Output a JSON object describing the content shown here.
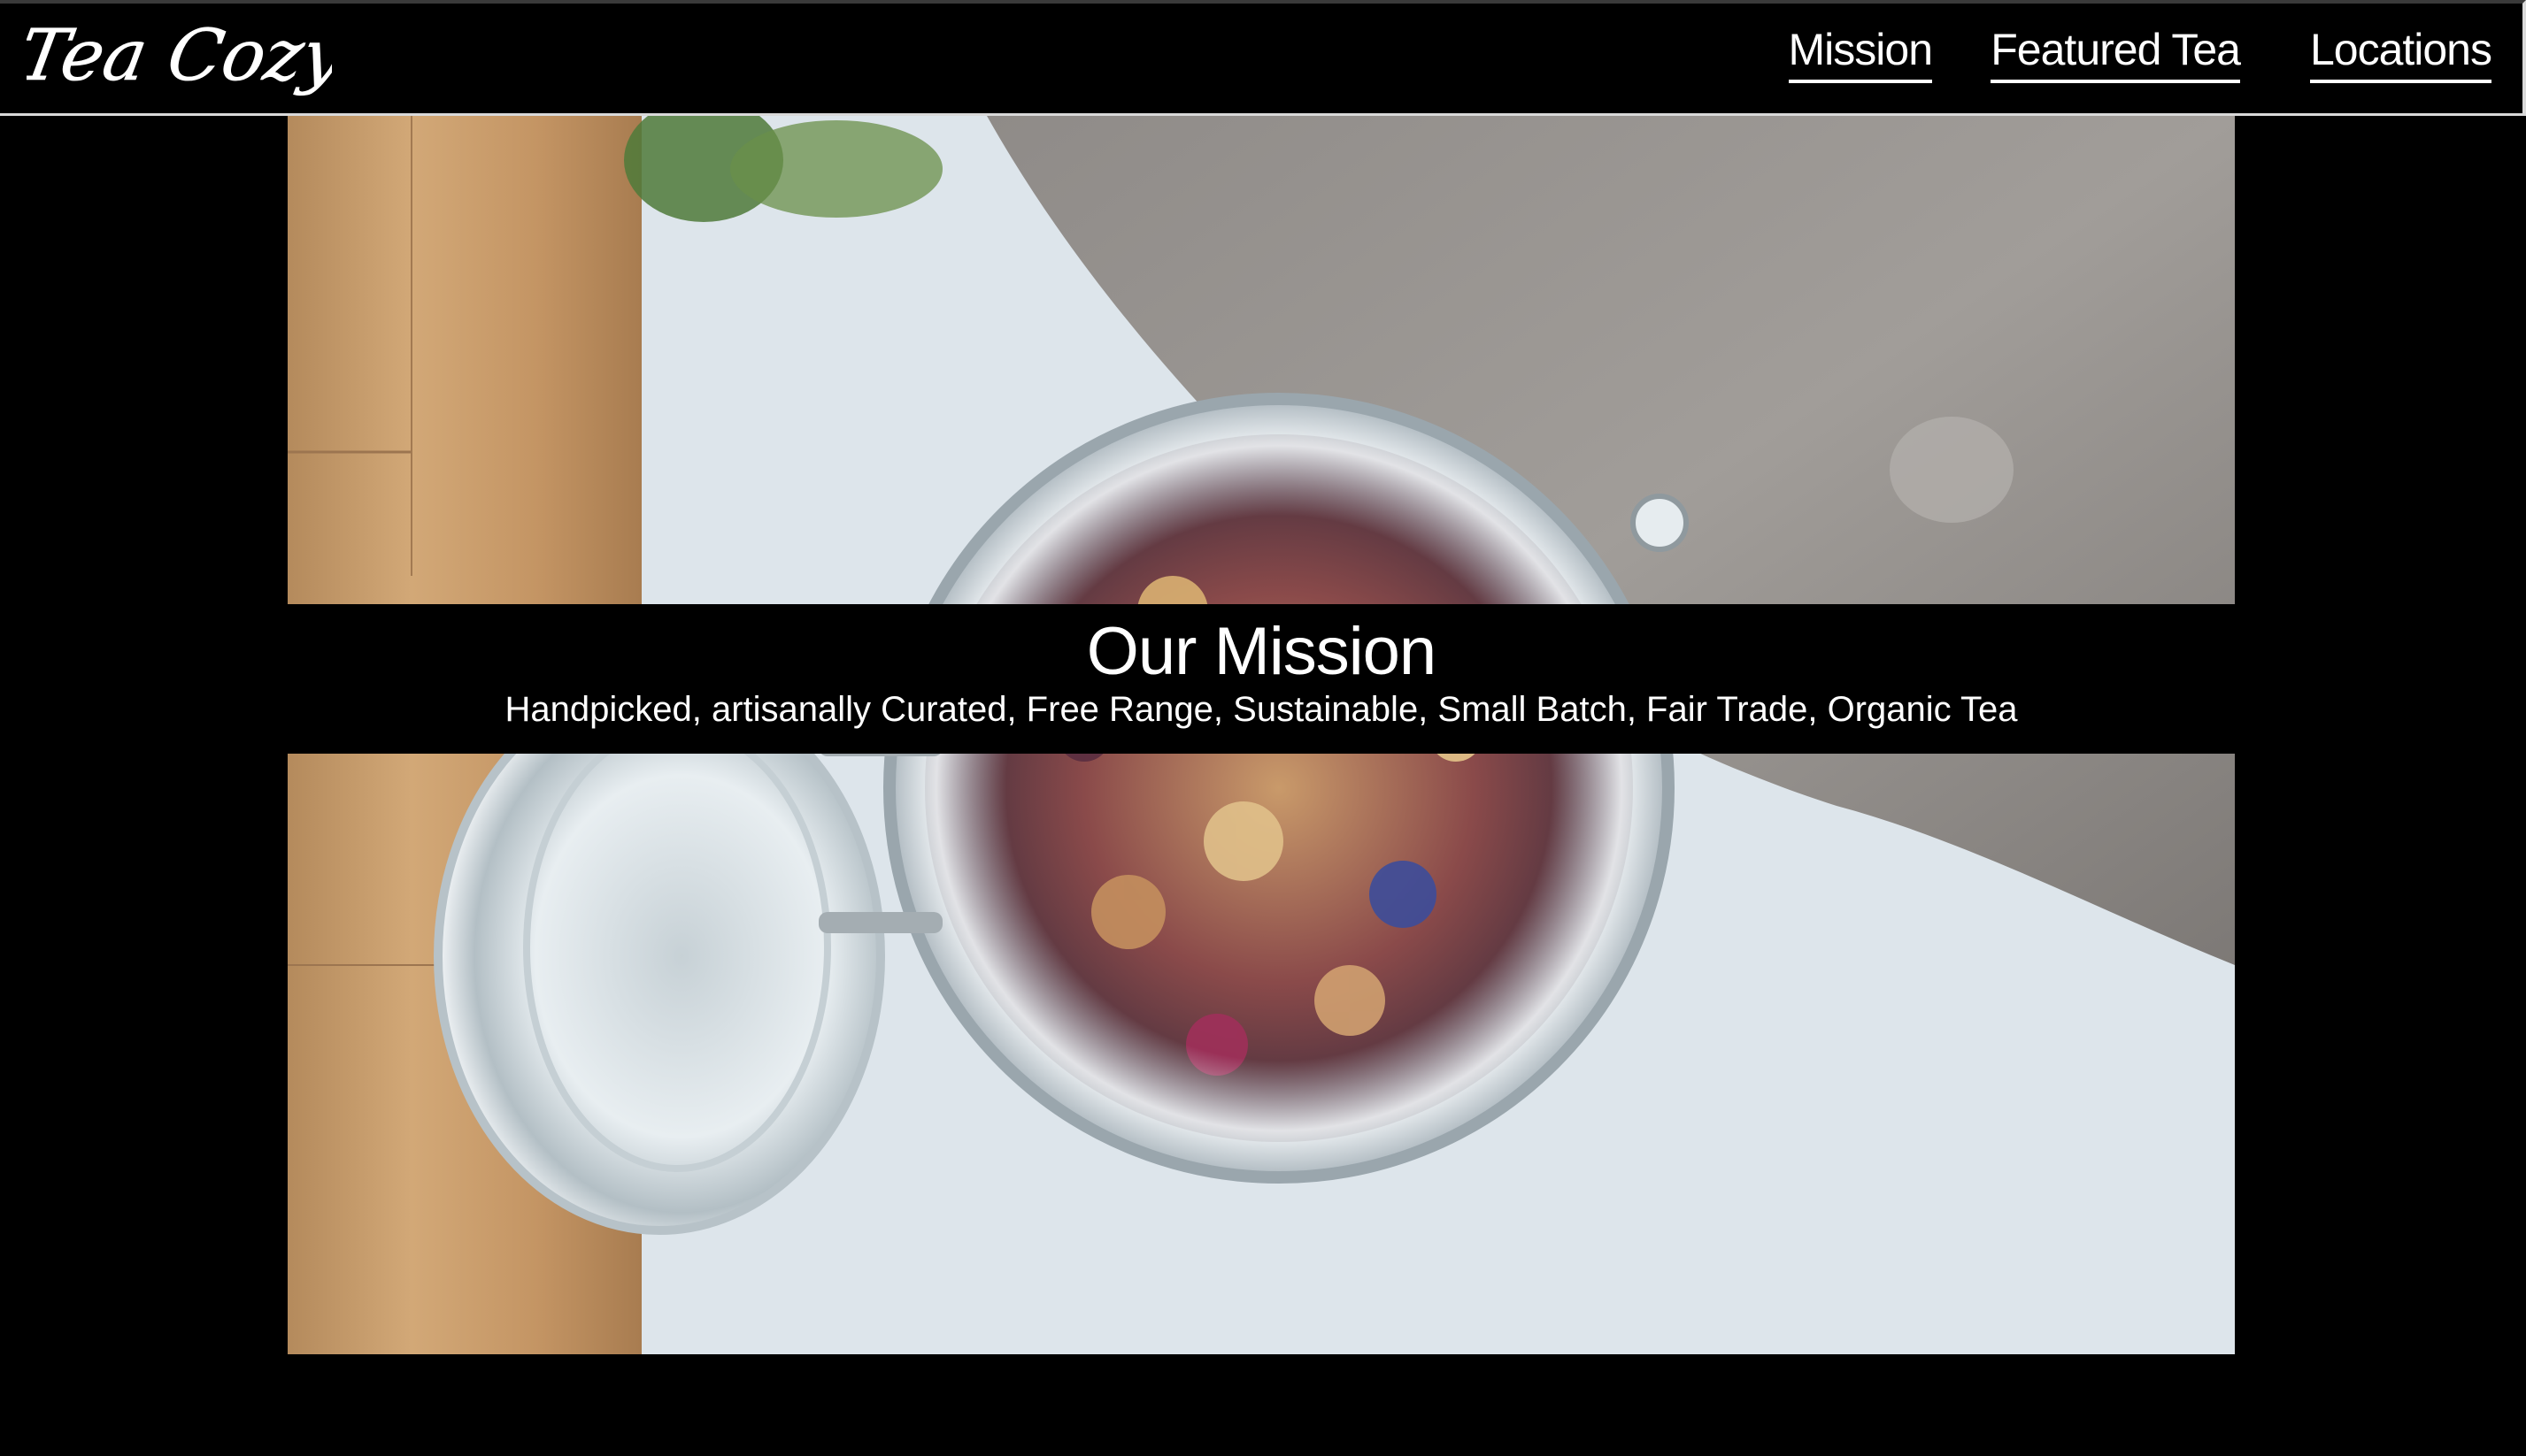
{
  "header": {
    "logo_text": "Tea Cozy",
    "nav": [
      {
        "label": "Mission"
      },
      {
        "label": "Featured Tea"
      },
      {
        "label": "Locations"
      }
    ]
  },
  "hero": {
    "title": "Our Mission",
    "subtitle": "Handpicked, artisanally Curated, Free Range, Sustainable, Small Batch, Fair Trade, Organic Tea"
  },
  "colors": {
    "background": "#000000",
    "text": "#ffffff",
    "underline": "#ffffff"
  }
}
